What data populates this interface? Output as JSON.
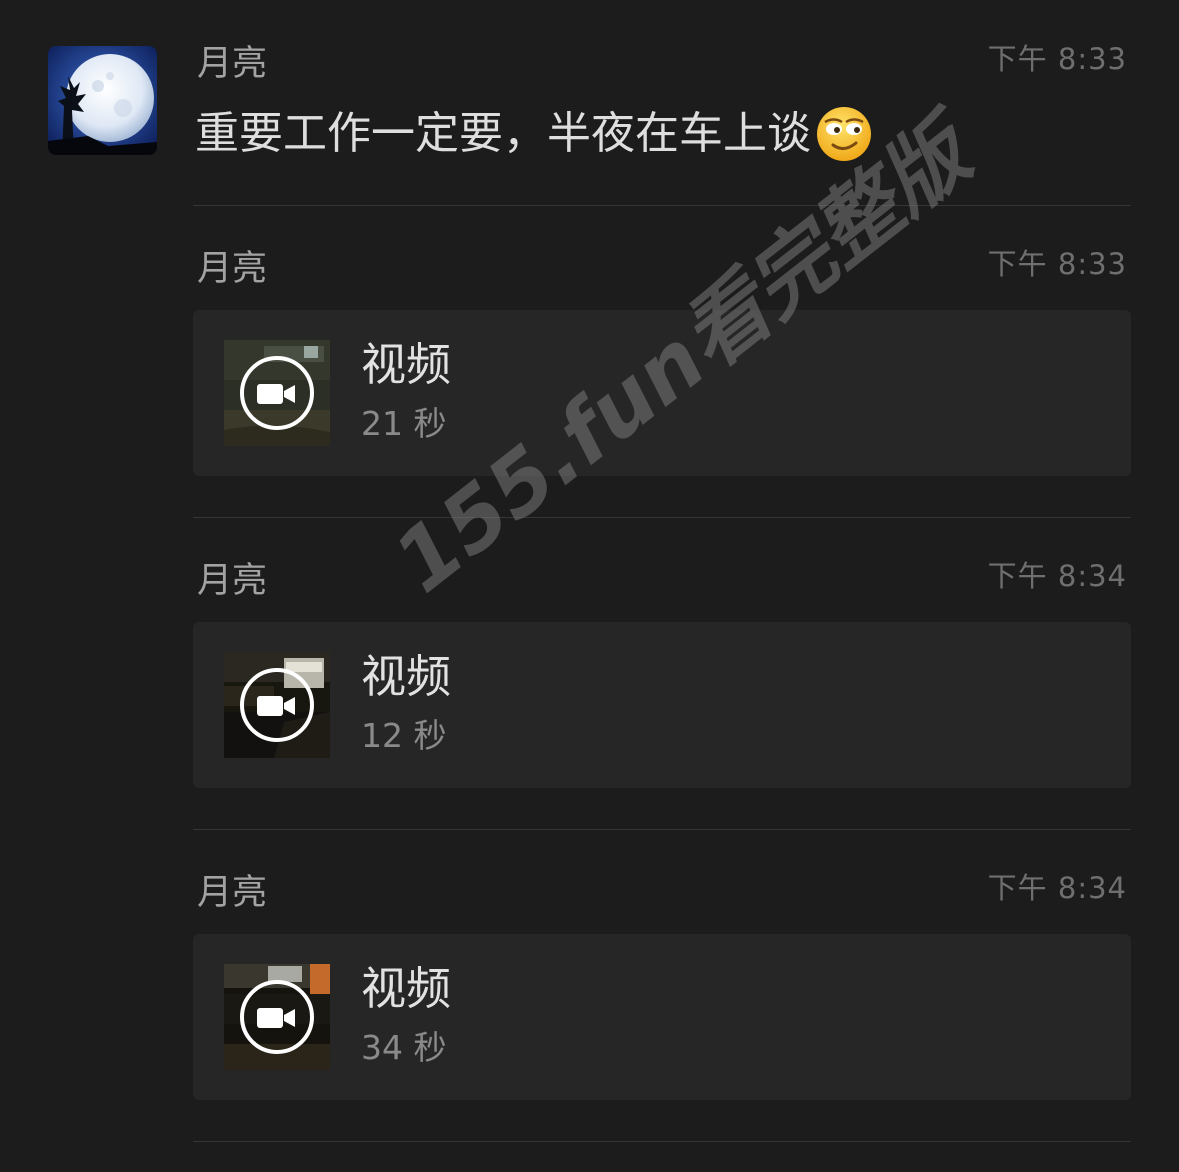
{
  "messages": [
    {
      "sender": "月亮",
      "time": "下午 8:33",
      "type": "text",
      "text": "重要工作一定要，半夜在车上谈",
      "emoji": "smirk-emoji"
    },
    {
      "sender": "月亮",
      "time": "下午 8:33",
      "type": "video",
      "title": "视频",
      "duration": "21 秒"
    },
    {
      "sender": "月亮",
      "time": "下午 8:34",
      "type": "video",
      "title": "视频",
      "duration": "12 秒"
    },
    {
      "sender": "月亮",
      "time": "下午 8:34",
      "type": "video",
      "title": "视频",
      "duration": "34 秒"
    }
  ],
  "icons": {
    "avatar": "moon-avatar",
    "video": "video-camera-icon"
  },
  "colors": {
    "background": "#1c1c1c",
    "card": "#262626",
    "divider": "#353535"
  },
  "watermark": "155.fun看完整版"
}
